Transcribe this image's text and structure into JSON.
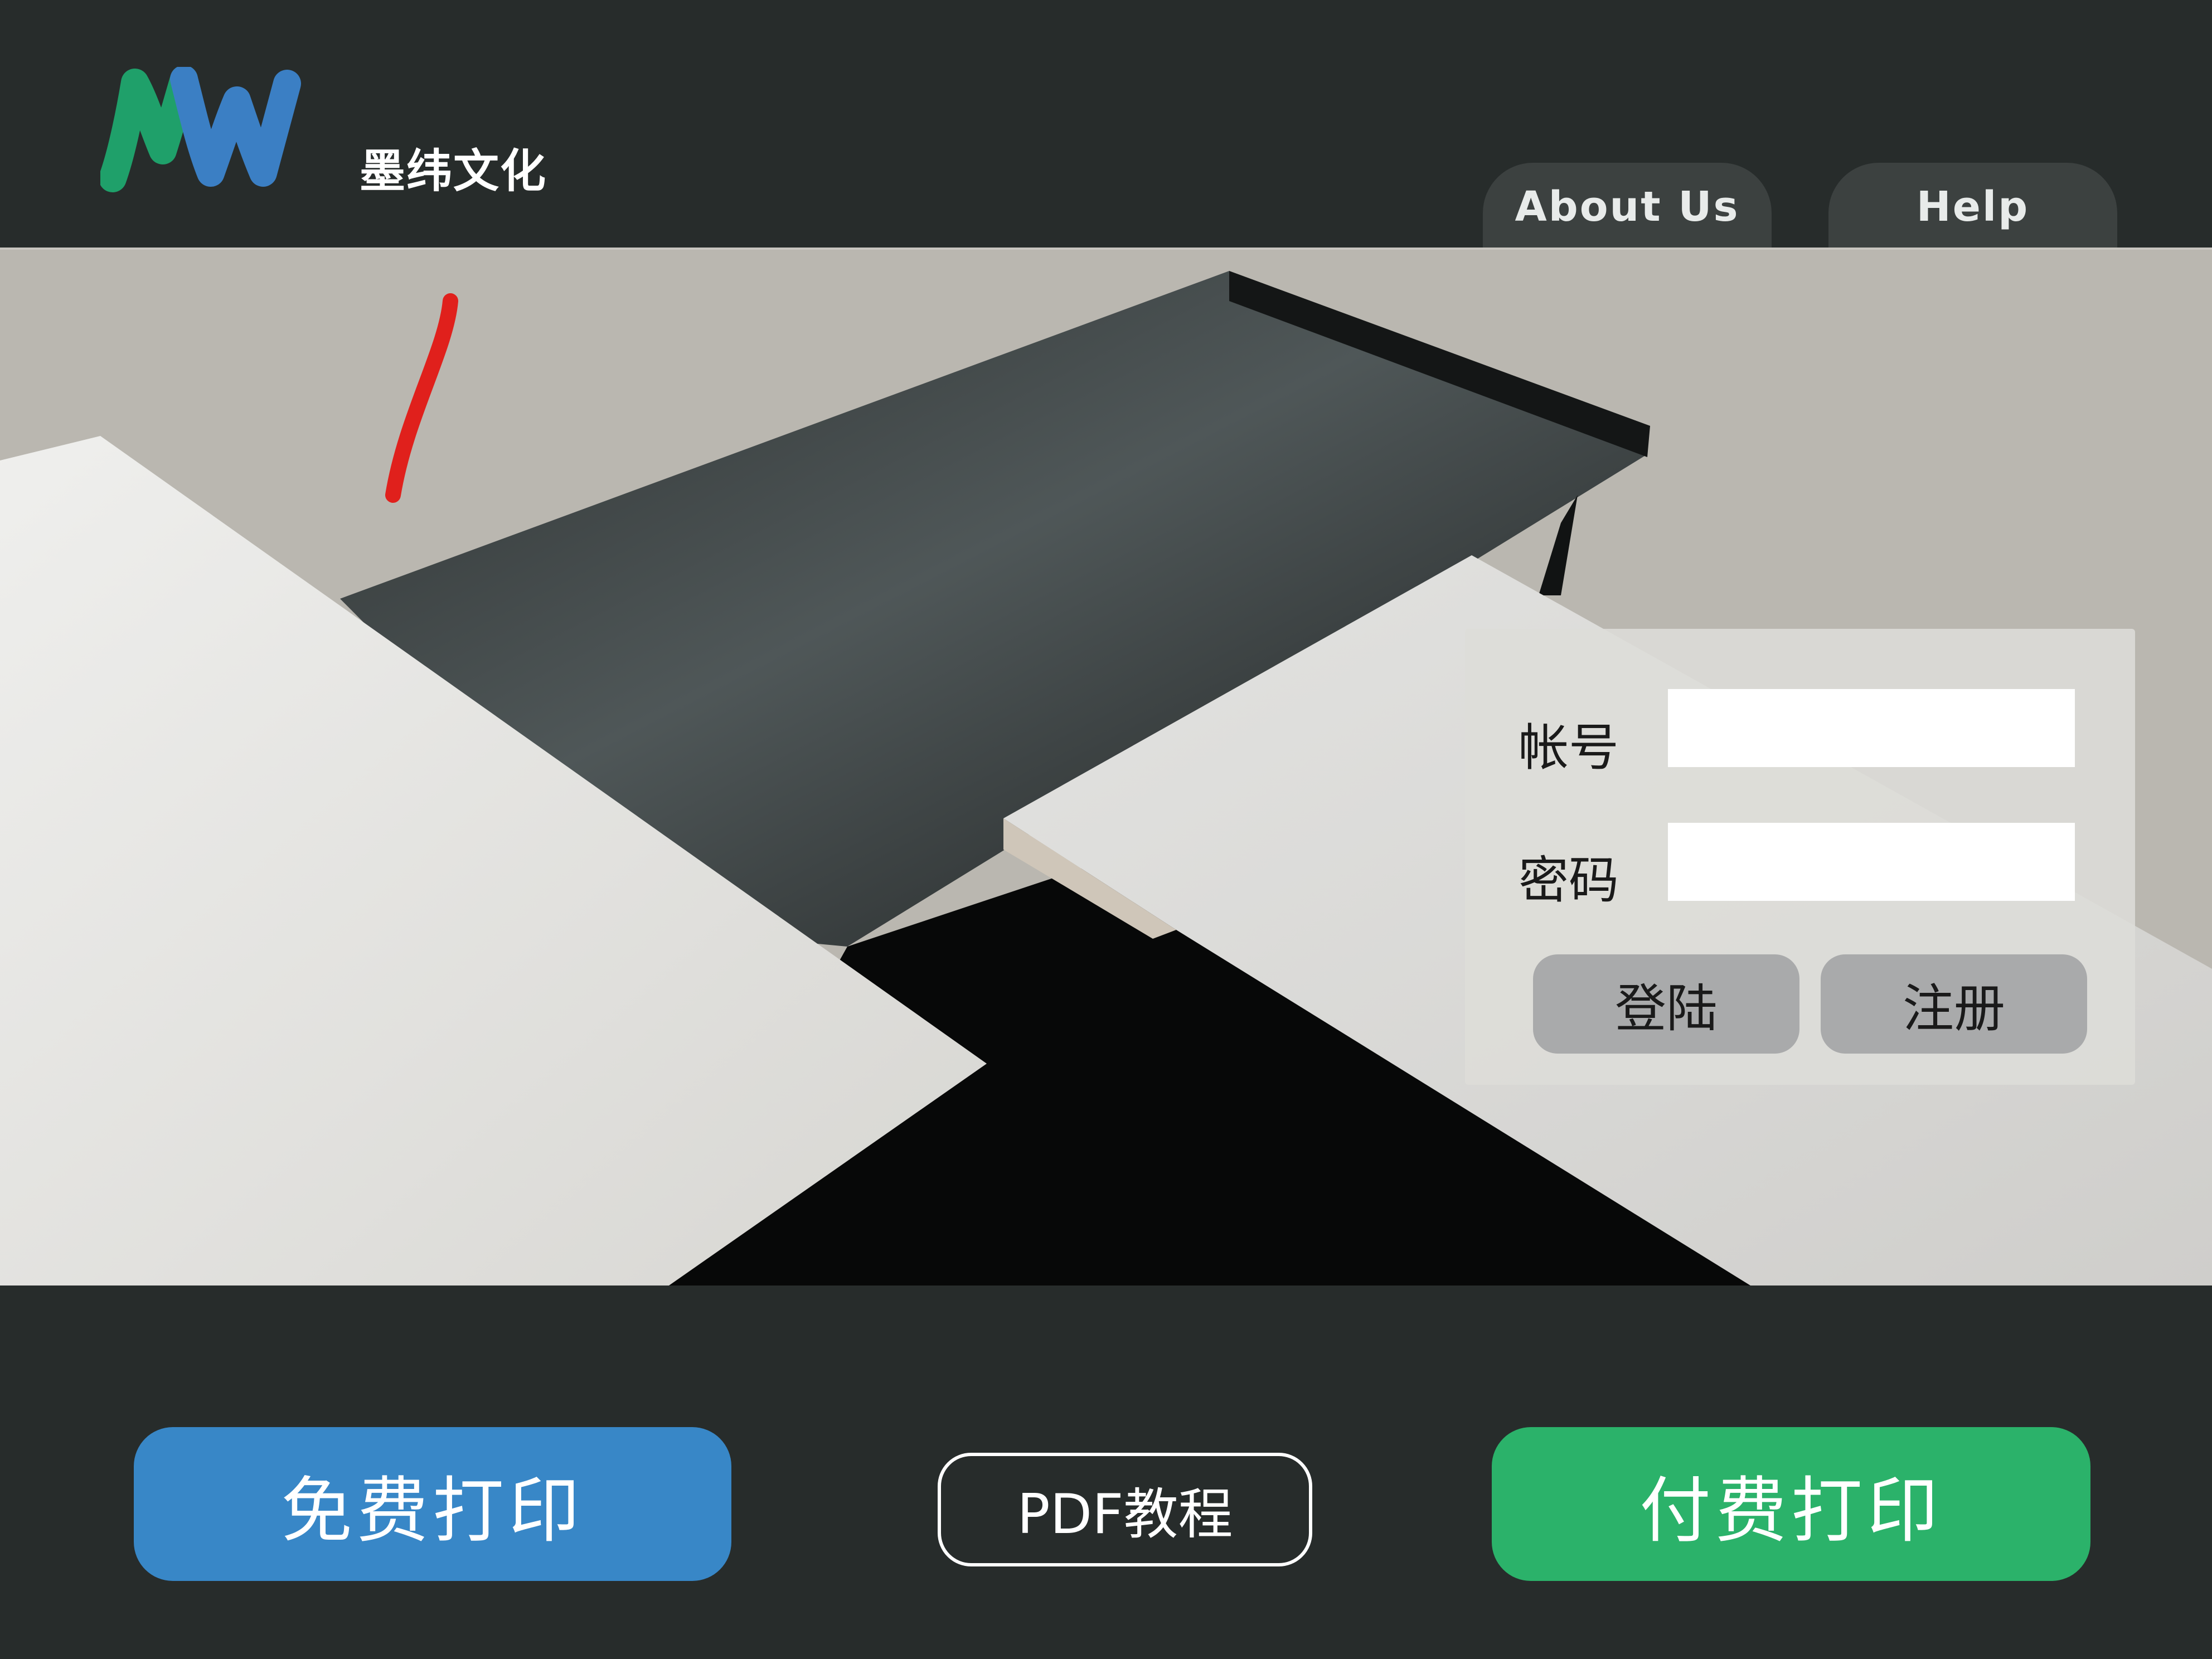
{
  "header": {
    "brand_name": "墨纬文化",
    "logo_letters": "MW",
    "nav": {
      "about_label": "About Us",
      "help_label": "Help"
    }
  },
  "login": {
    "account_label": "帐号",
    "account_value": "",
    "password_label": "密码",
    "password_value": "",
    "login_button": "登陆",
    "register_button": "注册"
  },
  "actions": {
    "free_print": "免费打印",
    "pdf_tutorial": "PDF教程",
    "paid_print": "付费打印"
  },
  "colors": {
    "background": "#272c2b",
    "free_print": "#3887c7",
    "paid_print": "#2bb26a",
    "logo_green": "#1fa06a",
    "logo_blue": "#3b7fc4",
    "accent_red": "#e0201c"
  }
}
